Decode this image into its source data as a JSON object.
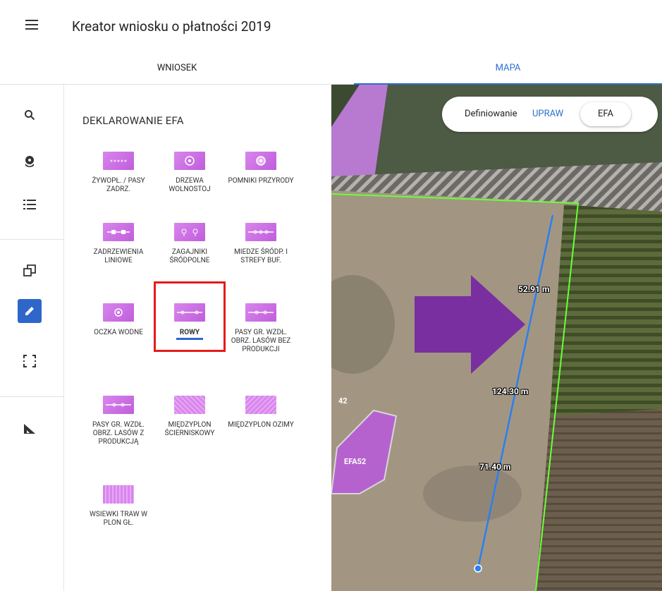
{
  "app": {
    "title": "Kreator wniosku o płatności 2019"
  },
  "tabs": [
    {
      "label": "WNIOSEK",
      "active": false
    },
    {
      "label": "MAPA",
      "active": true
    }
  ],
  "panel": {
    "heading": "DEKLAROWANIE EFA",
    "tiles": [
      {
        "label": "ŻYWOPŁ. / PASY ZADRZ.",
        "icon": "hedge-icon"
      },
      {
        "label": "DRZEWA WOLNOSTOJ",
        "icon": "tree-icon"
      },
      {
        "label": "POMNIKI PRZYRODY",
        "icon": "monument-icon"
      },
      {
        "label": "ZADRZEWIENIA LINIOWE",
        "icon": "line-trees-icon"
      },
      {
        "label": "ZAGAJNIKI ŚRÓDPOLNE",
        "icon": "grove-icon"
      },
      {
        "label": "MIEDZE ŚRÓDP. I STREFY BUF.",
        "icon": "balk-icon"
      },
      {
        "label": "OCZKA WODNE",
        "icon": "pond-icon"
      },
      {
        "label": "ROWY",
        "icon": "ditch-icon",
        "selected": true
      },
      {
        "label": "PASY GR. WZDŁ. OBRZ. LASÓW BEZ PRODUKCJI",
        "icon": "forest-strip-icon"
      },
      {
        "label": "PASY GR. WZDŁ. OBRZ. LASÓW Z PRODUKCJĄ",
        "icon": "forest-strip-prod-icon"
      },
      {
        "label": "MIĘDZYPLON ŚCIERNISKOWY",
        "icon": "catch-crop-icon"
      },
      {
        "label": "MIĘDZYPLON OZIMY",
        "icon": "winter-crop-icon"
      },
      {
        "label": "WSIEWKI TRAW W PLON GŁ.",
        "icon": "grass-undersow-icon"
      }
    ]
  },
  "toggle": {
    "prefix": "Definiowanie",
    "option_upraw": "UPRAW",
    "option_efa": "EFA"
  },
  "map": {
    "parcel_number": "42",
    "efa_label": "EFA52",
    "measure_top": "52.91 m",
    "measure_total": "124.30 m",
    "measure_bottom": "71.40 m"
  },
  "colors": {
    "accent": "#2f66c9",
    "efa": "#c05ddc",
    "highlight": "#e51b1b",
    "arrow": "#7a2fa0",
    "parcel_border": "#6aff3a"
  }
}
